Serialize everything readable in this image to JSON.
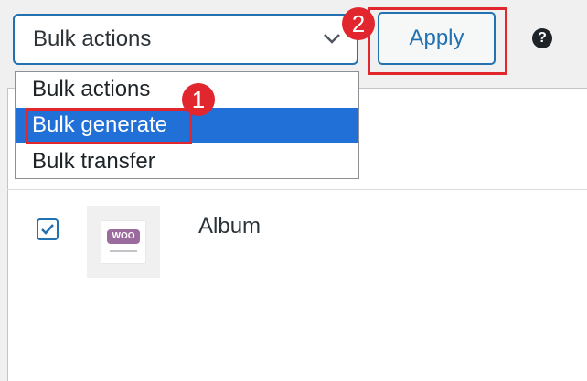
{
  "bulk": {
    "selected_label": "Bulk actions",
    "options": [
      {
        "label": "Bulk actions"
      },
      {
        "label": "Bulk generate"
      },
      {
        "label": "Bulk transfer"
      }
    ],
    "highlighted_index": 1
  },
  "apply_label": "Apply",
  "help_glyph": "?",
  "annotations": {
    "step1": "1",
    "step2": "2",
    "color": "#e1262e"
  },
  "row": {
    "checked": true,
    "product_name": "Album",
    "thumb_logo_text": "WOO"
  },
  "colors": {
    "accent": "#2271b1",
    "highlight": "#2170d8"
  },
  "icons": [
    "chevron-down-icon",
    "help-icon",
    "checkmark-icon"
  ]
}
